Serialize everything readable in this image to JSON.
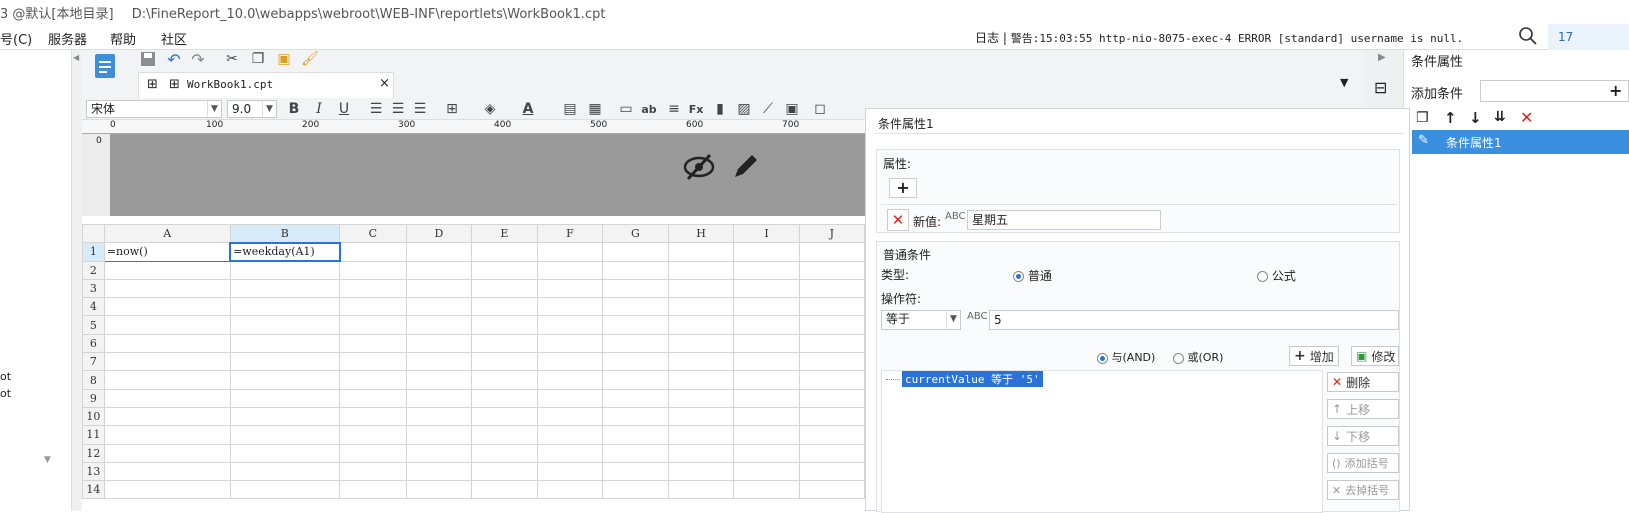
{
  "window": {
    "title_prefix": "3 @默认[本地目录]",
    "title_path": "D:\\FineReport_10.0\\webapps\\webroot\\WEB-INF\\reportlets\\WorkBook1.cpt"
  },
  "menu": {
    "items": [
      "号(C)",
      "服务器",
      "帮助",
      "社区"
    ],
    "log_label": "日志",
    "log_sep": "|",
    "log_text": "警告:15:03:55 http-nio-8075-exec-4 ERROR [standard] username is null.",
    "right_num": "17"
  },
  "tab": {
    "name": "WorkBook1.cpt",
    "close": "×"
  },
  "format": {
    "font": "宋体",
    "size": "9.0"
  },
  "ruler": {
    "ticks": [
      "0",
      "100",
      "200",
      "300",
      "400",
      "500",
      "600",
      "700"
    ],
    "v0": "0"
  },
  "grid": {
    "columns": [
      "A",
      "B",
      "C",
      "D",
      "E",
      "F",
      "G",
      "H",
      "I",
      "J"
    ],
    "rows": [
      "1",
      "2",
      "3",
      "4",
      "5",
      "6",
      "7",
      "8",
      "9",
      "10",
      "11",
      "12",
      "13",
      "14"
    ],
    "a1": "=now()",
    "b1": "=weekday(A1)"
  },
  "left": {
    "items": [
      "ot",
      "ot"
    ]
  },
  "dialog": {
    "title": "条件属性1",
    "attr_label": "属性:",
    "new_value_label": "新值:",
    "new_value": "星期五",
    "normal_cond": "普通条件",
    "type_label": "类型:",
    "type_normal": "普通",
    "type_formula": "公式",
    "operator_label": "操作符:",
    "operator": "等于",
    "operand": "5",
    "and_label": "与(AND)",
    "or_label": "或(OR)",
    "add_btn": "增加",
    "modify_btn": "修改",
    "condition_item": "currentValue 等于 '5'",
    "delete_btn": "删除",
    "up_btn": "上移",
    "down_btn": "下移",
    "add_bracket_btn": "添加括号",
    "remove_bracket_btn": "去掉括号"
  },
  "right": {
    "title": "条件属性",
    "add_condition": "添加条件",
    "list_item": "条件属性1"
  }
}
